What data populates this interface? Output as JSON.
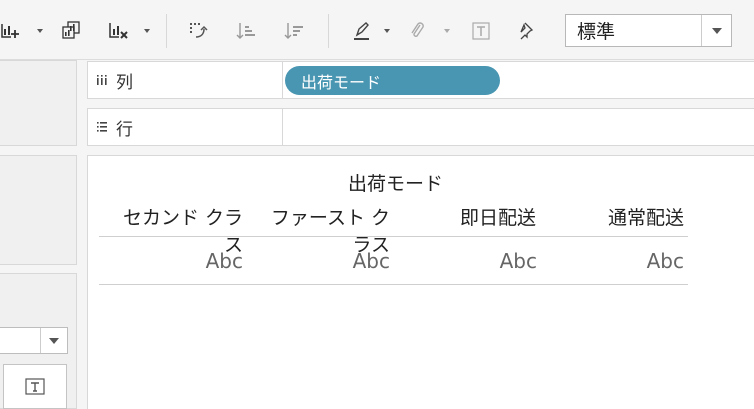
{
  "toolbar": {
    "icons": [
      "new-sheet-icon",
      "duplicate-sheet-icon",
      "clear-sheet-icon",
      "swap-icon",
      "sort-ascending-icon",
      "sort-descending-icon",
      "highlight-icon",
      "annotate-icon",
      "text-icon",
      "pin-icon"
    ],
    "fit_select": {
      "value": "標準"
    }
  },
  "shelves": {
    "columns": {
      "label": "列",
      "pill": "出荷モード"
    },
    "rows": {
      "label": "行"
    }
  },
  "view": {
    "title": "出荷モード",
    "headers": [
      "セカンド クラス",
      "ファースト クラス",
      "即日配送",
      "通常配送"
    ],
    "cells": [
      "Abc",
      "Abc",
      "Abc",
      "Abc"
    ]
  },
  "colors": {
    "pill": "#4996b2",
    "toolbar_bg": "#f5f5f5"
  }
}
